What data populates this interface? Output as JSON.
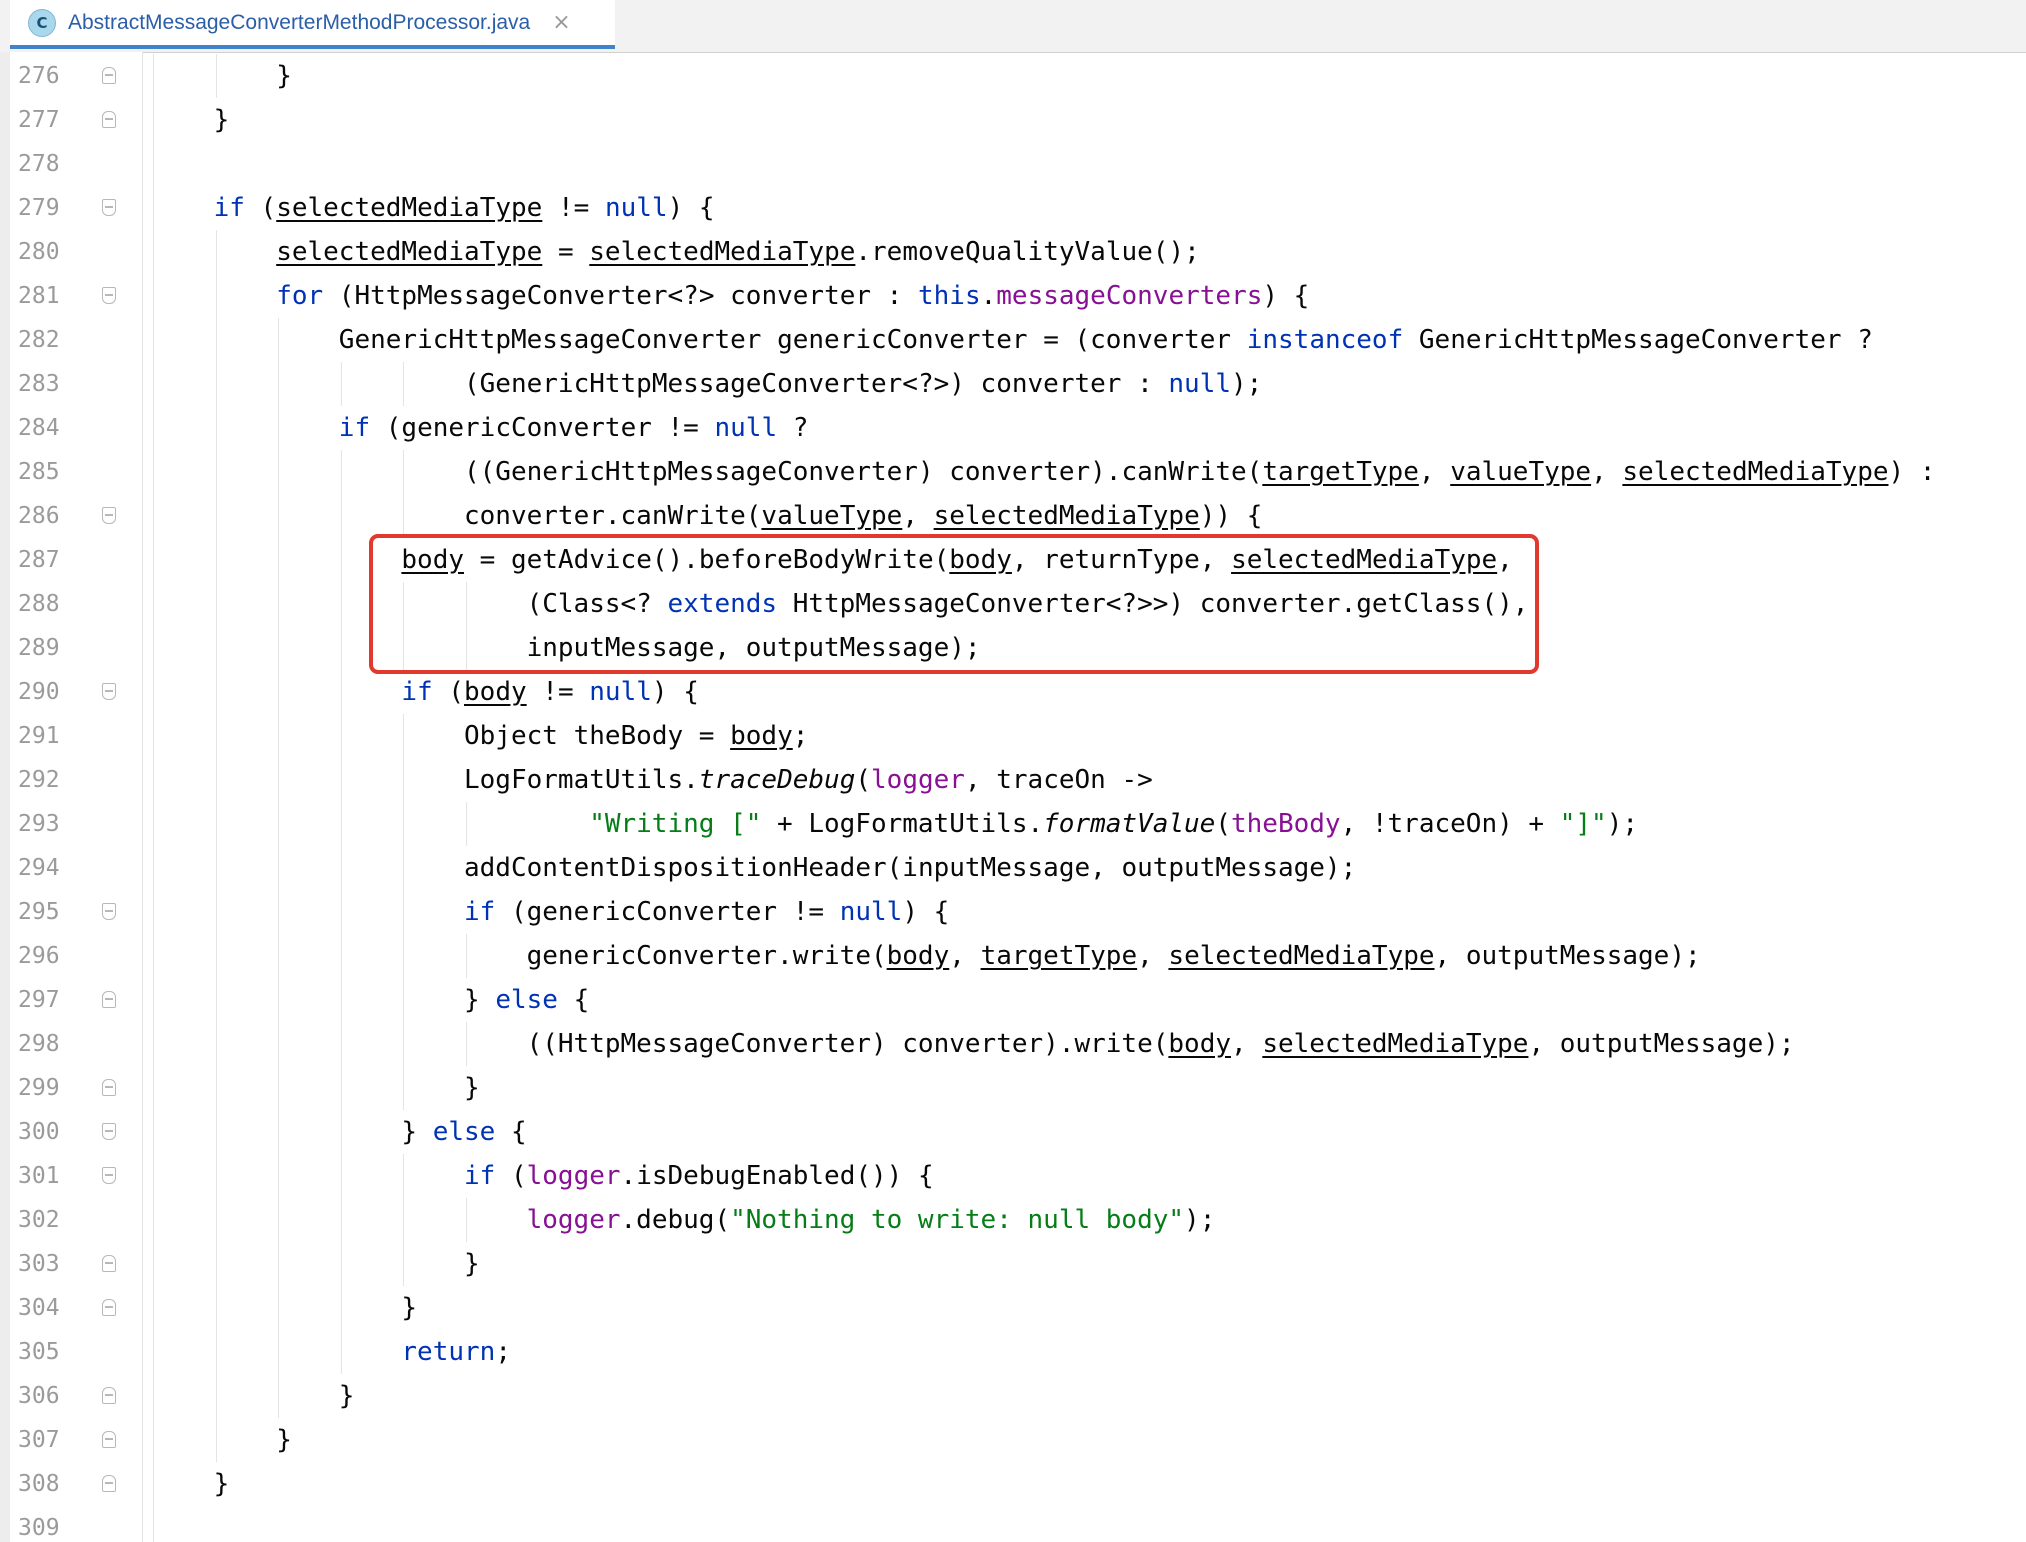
{
  "tab": {
    "icon_letter": "C",
    "title": "AbstractMessageConverterMethodProcessor.java",
    "close_glyph": "×"
  },
  "lines": [
    {
      "n": "276",
      "indent": 2,
      "fold": "end",
      "tokens": [
        {
          "t": "}"
        }
      ]
    },
    {
      "n": "277",
      "indent": 1,
      "fold": "end",
      "tokens": [
        {
          "t": "}"
        }
      ]
    },
    {
      "n": "278",
      "indent": 0,
      "fold": "",
      "tokens": []
    },
    {
      "n": "279",
      "indent": 1,
      "fold": "start",
      "tokens": [
        {
          "t": "if",
          "c": "kw"
        },
        {
          "t": " ("
        },
        {
          "t": "selectedMediaType",
          "c": "u"
        },
        {
          "t": " != "
        },
        {
          "t": "null",
          "c": "kw"
        },
        {
          "t": ") {"
        }
      ]
    },
    {
      "n": "280",
      "indent": 2,
      "fold": "",
      "tokens": [
        {
          "t": "selectedMediaType",
          "c": "u"
        },
        {
          "t": " = "
        },
        {
          "t": "selectedMediaType",
          "c": "u"
        },
        {
          "t": ".removeQualityValue();"
        }
      ]
    },
    {
      "n": "281",
      "indent": 2,
      "fold": "start",
      "tokens": [
        {
          "t": "for",
          "c": "kw"
        },
        {
          "t": " (HttpMessageConverter<?> converter : "
        },
        {
          "t": "this",
          "c": "kw"
        },
        {
          "t": "."
        },
        {
          "t": "messageConverters",
          "c": "fld"
        },
        {
          "t": ") {"
        }
      ]
    },
    {
      "n": "282",
      "indent": 3,
      "fold": "",
      "tokens": [
        {
          "t": "GenericHttpMessageConverter genericConverter = (converter "
        },
        {
          "t": "instanceof",
          "c": "kw"
        },
        {
          "t": " GenericHttpMessageConverter ?"
        }
      ]
    },
    {
      "n": "283",
      "indent": 5,
      "fold": "",
      "tokens": [
        {
          "t": "(GenericHttpMessageConverter<?>) converter : "
        },
        {
          "t": "null",
          "c": "kw"
        },
        {
          "t": ");"
        }
      ]
    },
    {
      "n": "284",
      "indent": 3,
      "fold": "",
      "tokens": [
        {
          "t": "if",
          "c": "kw"
        },
        {
          "t": " (genericConverter != "
        },
        {
          "t": "null",
          "c": "kw"
        },
        {
          "t": " ?"
        }
      ]
    },
    {
      "n": "285",
      "indent": 5,
      "fold": "",
      "tokens": [
        {
          "t": "((GenericHttpMessageConverter) converter).canWrite("
        },
        {
          "t": "targetType",
          "c": "u"
        },
        {
          "t": ", "
        },
        {
          "t": "valueType",
          "c": "u"
        },
        {
          "t": ", "
        },
        {
          "t": "selectedMediaType",
          "c": "u"
        },
        {
          "t": ") :"
        }
      ]
    },
    {
      "n": "286",
      "indent": 5,
      "fold": "start",
      "tokens": [
        {
          "t": "converter.canWrite("
        },
        {
          "t": "valueType",
          "c": "u"
        },
        {
          "t": ", "
        },
        {
          "t": "selectedMediaType",
          "c": "u"
        },
        {
          "t": ")) {"
        }
      ]
    },
    {
      "n": "287",
      "indent": 4,
      "fold": "",
      "tokens": [
        {
          "t": "body",
          "c": "u"
        },
        {
          "t": " = getAdvice().beforeBodyWrite("
        },
        {
          "t": "body",
          "c": "u"
        },
        {
          "t": ", returnType, "
        },
        {
          "t": "selectedMediaType",
          "c": "u"
        },
        {
          "t": ","
        }
      ]
    },
    {
      "n": "288",
      "indent": 6,
      "fold": "",
      "tokens": [
        {
          "t": "(Class<? "
        },
        {
          "t": "extends",
          "c": "kw"
        },
        {
          "t": " HttpMessageConverter<?>>) converter.getClass(),"
        }
      ]
    },
    {
      "n": "289",
      "indent": 6,
      "fold": "",
      "tokens": [
        {
          "t": "inputMessage, outputMessage);"
        }
      ]
    },
    {
      "n": "290",
      "indent": 4,
      "fold": "start",
      "tokens": [
        {
          "t": "if",
          "c": "kw"
        },
        {
          "t": " ("
        },
        {
          "t": "body",
          "c": "u"
        },
        {
          "t": " != "
        },
        {
          "t": "null",
          "c": "kw"
        },
        {
          "t": ") {"
        }
      ]
    },
    {
      "n": "291",
      "indent": 5,
      "fold": "",
      "tokens": [
        {
          "t": "Object theBody = "
        },
        {
          "t": "body",
          "c": "u"
        },
        {
          "t": ";"
        }
      ]
    },
    {
      "n": "292",
      "indent": 5,
      "fold": "",
      "tokens": [
        {
          "t": "LogFormatUtils."
        },
        {
          "t": "traceDebug",
          "c": "it"
        },
        {
          "t": "("
        },
        {
          "t": "logger",
          "c": "fld"
        },
        {
          "t": ", traceOn ->"
        }
      ]
    },
    {
      "n": "293",
      "indent": 7,
      "fold": "",
      "tokens": [
        {
          "t": "\"Writing [\"",
          "c": "str"
        },
        {
          "t": " + LogFormatUtils."
        },
        {
          "t": "formatValue",
          "c": "it"
        },
        {
          "t": "("
        },
        {
          "t": "theBody",
          "c": "fld"
        },
        {
          "t": ", !traceOn) + "
        },
        {
          "t": "\"]\"",
          "c": "str"
        },
        {
          "t": ");"
        }
      ]
    },
    {
      "n": "294",
      "indent": 5,
      "fold": "",
      "tokens": [
        {
          "t": "addContentDispositionHeader(inputMessage, outputMessage);"
        }
      ]
    },
    {
      "n": "295",
      "indent": 5,
      "fold": "start",
      "tokens": [
        {
          "t": "if",
          "c": "kw"
        },
        {
          "t": " (genericConverter != "
        },
        {
          "t": "null",
          "c": "kw"
        },
        {
          "t": ") {"
        }
      ]
    },
    {
      "n": "296",
      "indent": 6,
      "fold": "",
      "tokens": [
        {
          "t": "genericConverter.write("
        },
        {
          "t": "body",
          "c": "u"
        },
        {
          "t": ", "
        },
        {
          "t": "targetType",
          "c": "u"
        },
        {
          "t": ", "
        },
        {
          "t": "selectedMediaType",
          "c": "u"
        },
        {
          "t": ", outputMessage);"
        }
      ]
    },
    {
      "n": "297",
      "indent": 5,
      "fold": "end",
      "tokens": [
        {
          "t": "} "
        },
        {
          "t": "else",
          "c": "kw"
        },
        {
          "t": " {"
        }
      ]
    },
    {
      "n": "298",
      "indent": 6,
      "fold": "",
      "tokens": [
        {
          "t": "((HttpMessageConverter) converter).write("
        },
        {
          "t": "body",
          "c": "u"
        },
        {
          "t": ", "
        },
        {
          "t": "selectedMediaType",
          "c": "u"
        },
        {
          "t": ", outputMessage);"
        }
      ]
    },
    {
      "n": "299",
      "indent": 5,
      "fold": "end",
      "tokens": [
        {
          "t": "}"
        }
      ]
    },
    {
      "n": "300",
      "indent": 4,
      "fold": "start",
      "tokens": [
        {
          "t": "} "
        },
        {
          "t": "else",
          "c": "kw"
        },
        {
          "t": " {"
        }
      ]
    },
    {
      "n": "301",
      "indent": 5,
      "fold": "start",
      "tokens": [
        {
          "t": "if",
          "c": "kw"
        },
        {
          "t": " ("
        },
        {
          "t": "logger",
          "c": "fld"
        },
        {
          "t": ".isDebugEnabled()) {"
        }
      ]
    },
    {
      "n": "302",
      "indent": 6,
      "fold": "",
      "tokens": [
        {
          "t": "logger",
          "c": "fld"
        },
        {
          "t": ".debug("
        },
        {
          "t": "\"Nothing to write: null body\"",
          "c": "str"
        },
        {
          "t": ");"
        }
      ]
    },
    {
      "n": "303",
      "indent": 5,
      "fold": "end",
      "tokens": [
        {
          "t": "}"
        }
      ]
    },
    {
      "n": "304",
      "indent": 4,
      "fold": "end",
      "tokens": [
        {
          "t": "}"
        }
      ]
    },
    {
      "n": "305",
      "indent": 4,
      "fold": "",
      "tokens": [
        {
          "t": "return",
          "c": "kw"
        },
        {
          "t": ";"
        }
      ]
    },
    {
      "n": "306",
      "indent": 3,
      "fold": "end",
      "tokens": [
        {
          "t": "}"
        }
      ]
    },
    {
      "n": "307",
      "indent": 2,
      "fold": "end",
      "tokens": [
        {
          "t": "}"
        }
      ]
    },
    {
      "n": "308",
      "indent": 1,
      "fold": "end",
      "tokens": [
        {
          "t": "}"
        }
      ]
    },
    {
      "n": "309",
      "indent": 0,
      "fold": "",
      "tokens": []
    }
  ],
  "highlight": {
    "color": "#e2392e",
    "from_line": "287",
    "to_line": "289"
  },
  "colors": {
    "keyword": "#0033b3",
    "field": "#871094",
    "string": "#067d17",
    "text": "#080808",
    "line_number": "#9a9a9a",
    "tab_accent": "#4083c9"
  }
}
